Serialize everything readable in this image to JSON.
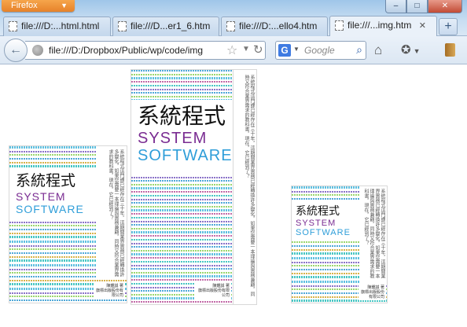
{
  "browser": {
    "app_menu_label": "Firefox",
    "window_controls": {
      "minimize": "–",
      "maximize": "□",
      "close": "✕"
    },
    "tabs": [
      {
        "label": "file:///D:...html.html",
        "active": false
      },
      {
        "label": "file:///D...er1_6.htm",
        "active": false
      },
      {
        "label": "file:///D:...ello4.htm",
        "active": false
      },
      {
        "label": "file:///...img.htm",
        "active": true
      }
    ],
    "new_tab_label": "+",
    "url": "file:///D:/Dropbox/Public/wp/code/img",
    "search_engine": "G",
    "search_placeholder": "Google"
  },
  "page": {
    "book": {
      "title_cn": "系統程式",
      "title_en_line1": "SYSTEM",
      "title_en_line2": "SOFTWARE",
      "blurb": "系統程式這門課已經存在三十年，這期間業界實務已經轉換許多變化，如果您需要一本理論與實務兼顧，同時又符合業界需求的教科書，現在，它已經到了？",
      "author": "陳鍾誠 著",
      "publisher": "旗標出版股份有限公司"
    }
  }
}
